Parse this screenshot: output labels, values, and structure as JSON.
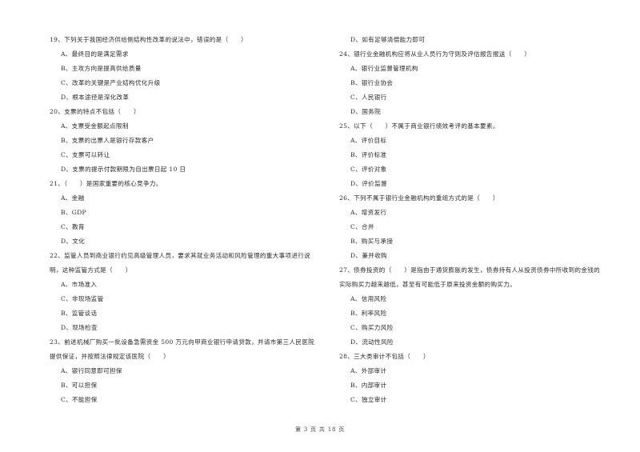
{
  "left_column": [
    {
      "type": "question",
      "text": "19、下列关于我国经济供给侧结构性改革的说法中，错误的是（　　）"
    },
    {
      "type": "option",
      "text": "A、最终目的是满足需求"
    },
    {
      "type": "option",
      "text": "B、主攻方向是提高供给质量"
    },
    {
      "type": "option",
      "text": "C、改革的关键是产业结构优化升级"
    },
    {
      "type": "option",
      "text": "D、根本途径是深化改革"
    },
    {
      "type": "question",
      "text": "20、支票的特点不包括（　　）"
    },
    {
      "type": "option",
      "text": "A、支票受金额起点限制"
    },
    {
      "type": "option",
      "text": "B、支票的出票人是银行存款客户"
    },
    {
      "type": "option",
      "text": "C、支票可以转让"
    },
    {
      "type": "option",
      "text": "D、支票的提示付款期限为自出票日起 10 日"
    },
    {
      "type": "question",
      "text": "21、（　　）是国家重要的核心竞争力。"
    },
    {
      "type": "option",
      "text": "A、金融"
    },
    {
      "type": "option",
      "text": "B、GDP"
    },
    {
      "type": "option",
      "text": "C、教育"
    },
    {
      "type": "option",
      "text": "D、文化"
    },
    {
      "type": "question",
      "text": "22、监管人员到商业银行约见高级管理人员，要求其就业务活动和风险管理的重大事项进行说"
    },
    {
      "type": "question",
      "text": "明，这种监管方式是（　　）"
    },
    {
      "type": "option",
      "text": "A、市场准入"
    },
    {
      "type": "option",
      "text": "C、非现场监管"
    },
    {
      "type": "option",
      "text": "B、监管谈话"
    },
    {
      "type": "option",
      "text": "D、现场检查"
    },
    {
      "type": "question",
      "text": "23、前进机械厂购买一批设备急需资金 500 万元向甲商业银行申请贷款，并请市第三人民医院"
    },
    {
      "type": "question",
      "text": "提供保证，并按照法律规定该医院（　　）"
    },
    {
      "type": "option",
      "text": "A、银行同意即可担保"
    },
    {
      "type": "option",
      "text": "B、可以担保"
    },
    {
      "type": "option",
      "text": "C、不能担保"
    }
  ],
  "right_column": [
    {
      "type": "option",
      "text": "D、如有足够清偿能力即可"
    },
    {
      "type": "question",
      "text": "24、银行业金融机构应将从业人员行为守则及评估报告报送（　　）"
    },
    {
      "type": "option",
      "text": "A、银行业监督管理机构"
    },
    {
      "type": "option",
      "text": "B、银行业协会"
    },
    {
      "type": "option",
      "text": "C、人民银行"
    },
    {
      "type": "option",
      "text": "D、国务院"
    },
    {
      "type": "question",
      "text": "25、以下（　　）不属于商业银行绩效考评的基本要素。"
    },
    {
      "type": "option",
      "text": "A、评价目标"
    },
    {
      "type": "option",
      "text": "B、评价标准"
    },
    {
      "type": "option",
      "text": "C、评价对象"
    },
    {
      "type": "option",
      "text": "D、评价监督"
    },
    {
      "type": "question",
      "text": "26、下列不属于银行业金融机构的重组方式的是（　　）"
    },
    {
      "type": "option",
      "text": "A、增资发行"
    },
    {
      "type": "option",
      "text": "C、合并"
    },
    {
      "type": "option",
      "text": "B、购买与承接"
    },
    {
      "type": "option",
      "text": "D、兼并收购"
    },
    {
      "type": "question",
      "text": "27、债券投资的（　　）是指由于通货膨胀的发生，债券持有人从投资债券中所收到的金钱的"
    },
    {
      "type": "question",
      "text": "实际购买力越来越低，甚至有可能低于原来投资金额的购买力。"
    },
    {
      "type": "option",
      "text": "A、信用风险"
    },
    {
      "type": "option",
      "text": "B、利率风险"
    },
    {
      "type": "option",
      "text": "C、购买力风险"
    },
    {
      "type": "option",
      "text": "D、流动性风险"
    },
    {
      "type": "question",
      "text": "28、三大类审计不包括（　　）"
    },
    {
      "type": "option",
      "text": "A、外部审计"
    },
    {
      "type": "option",
      "text": "B、内部审计"
    },
    {
      "type": "option",
      "text": "C、独立审计"
    }
  ],
  "footer": {
    "page_label": "第 3 页 共 18 页"
  }
}
